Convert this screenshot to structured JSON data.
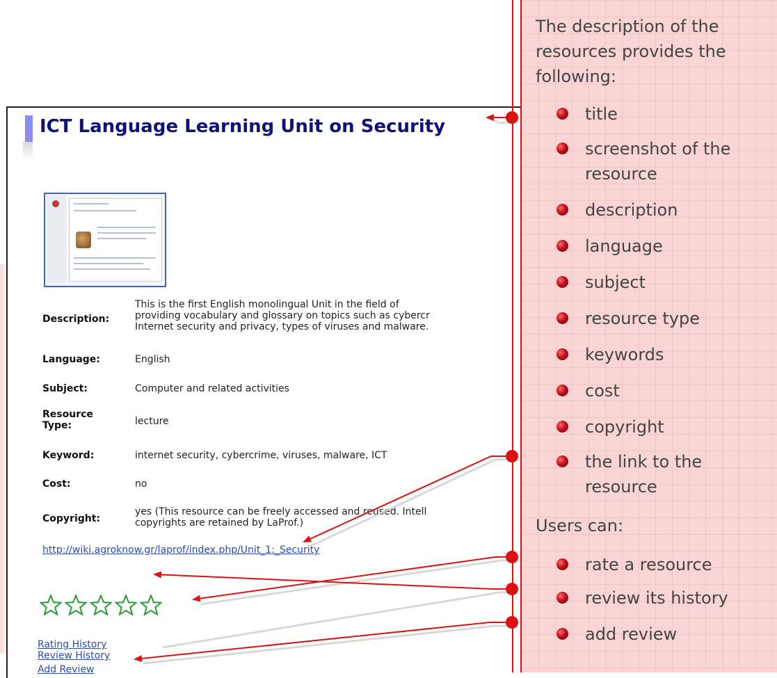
{
  "resource": {
    "title": "ICT Language Learning Unit on Security",
    "fields": [
      {
        "label": "Description:",
        "value": "This is the first English monolingual Unit in the field of\nproviding vocabulary and glossary on topics such as cybercr\nInternet security and privacy, types of viruses and malware."
      },
      {
        "label": "Language:",
        "value": "English"
      },
      {
        "label": "Subject:",
        "value": "Computer and related activities"
      },
      {
        "label": "Resource\nType:",
        "value": "lecture"
      },
      {
        "label": "Keyword:",
        "value": "internet security, cybercrime, viruses, malware, ICT"
      },
      {
        "label": "Cost:",
        "value": "no"
      },
      {
        "label": "Copyright:",
        "value": "yes (This resource can be freely accessed and reused. Intell\ncopyrights are retained by LaProf.)"
      }
    ],
    "link": "http://wiki.agroknow.gr/laprof/index.php/Unit_1:_Security",
    "rating_stars": 0,
    "rating_max": 5,
    "rating_history_label": "Rating History",
    "review_history_label": "Review History",
    "add_review_label": "Add Review"
  },
  "note": {
    "intro": "The description of the resources provides the following:",
    "items": [
      "title",
      "screenshot of the resource",
      "description",
      "language",
      "subject",
      "resource type",
      "keywords",
      "cost",
      "copyright",
      "the link to the resource"
    ],
    "users_intro": "Users can:",
    "user_items": [
      "rate a resource",
      "review its history",
      "add review"
    ]
  },
  "colors": {
    "accent_red": "#dd1111",
    "title_blue": "#11117a",
    "link_blue": "#2b4bb3",
    "note_bg": "#f9d5d5",
    "star_green": "#2f9e3a"
  }
}
